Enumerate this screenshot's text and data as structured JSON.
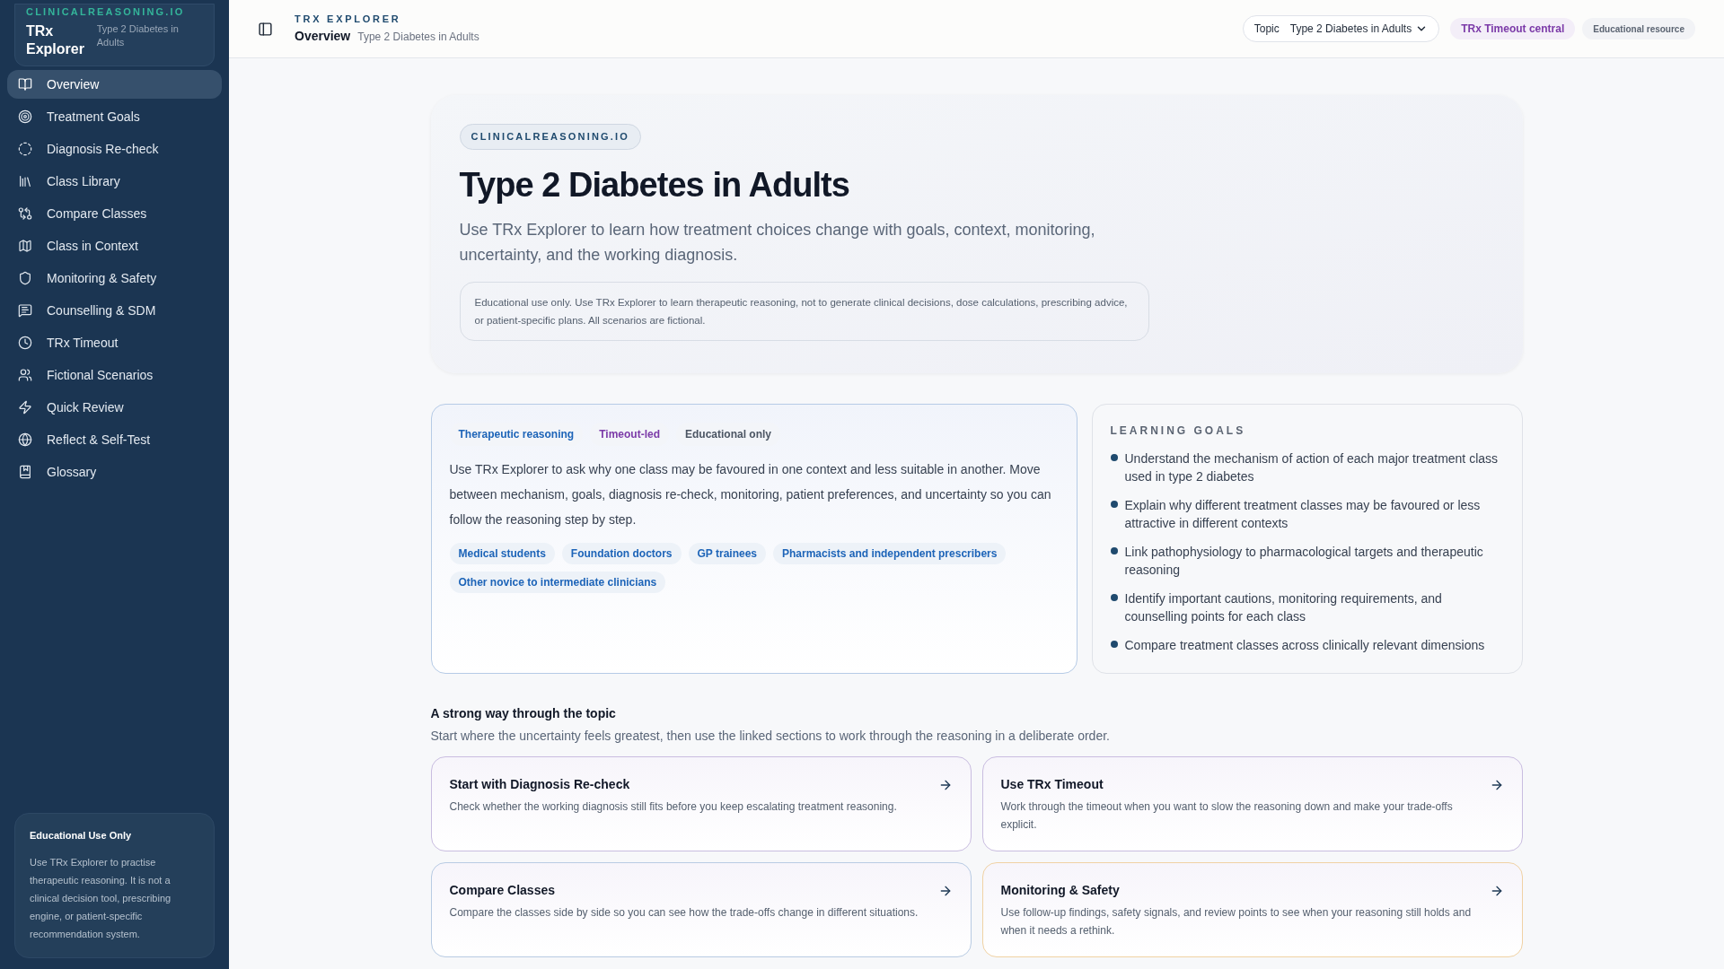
{
  "sidebar": {
    "brand": {
      "kicker": "CLINICALREASONING.IO",
      "title": "TRx Explorer",
      "subtitle": "Type 2 Diabetes in Adults"
    },
    "items": [
      {
        "label": "Overview",
        "selected": true
      },
      {
        "label": "Treatment Goals",
        "selected": false
      },
      {
        "label": "Diagnosis Re-check",
        "selected": false
      },
      {
        "label": "Class Library",
        "selected": false
      },
      {
        "label": "Compare Classes",
        "selected": false
      },
      {
        "label": "Class in Context",
        "selected": false
      },
      {
        "label": "Monitoring & Safety",
        "selected": false
      },
      {
        "label": "Counselling & SDM",
        "selected": false
      },
      {
        "label": "TRx Timeout",
        "selected": false
      },
      {
        "label": "Fictional Scenarios",
        "selected": false
      },
      {
        "label": "Quick Review",
        "selected": false
      },
      {
        "label": "Reflect & Self-Test",
        "selected": false
      },
      {
        "label": "Glossary",
        "selected": false
      }
    ],
    "notice": {
      "title": "Educational Use Only",
      "body": "Use TRx Explorer to practise therapeutic reasoning. It is not a clinical decision tool, prescribing engine, or patient-specific recommendation system."
    }
  },
  "header": {
    "kicker": "TRX EXPLORER",
    "title": "Overview",
    "subtitle": "Type 2 Diabetes in Adults",
    "topic_label": "Topic",
    "topic_value": "Type 2 Diabetes in Adults",
    "badges": [
      {
        "label": "TRx Timeout central",
        "color": "#7b3aa8"
      },
      {
        "label": "Educational resource",
        "color": "#5b6472"
      }
    ]
  },
  "hero": {
    "badge": "CLINICALREASONING.IO",
    "title": "Type 2 Diabetes in Adults",
    "lead": "Use TRx Explorer to learn how treatment choices change with goals, context, monitoring, uncertainty, and the working diagnosis.",
    "notice": "Educational use only. Use TRx Explorer to learn therapeutic reasoning, not to generate clinical decisions, dose calculations, prescribing advice, or patient-specific plans. All scenarios are fictional."
  },
  "intro": {
    "tags": [
      {
        "label": "Therapeutic reasoning",
        "color": "#1d64b8"
      },
      {
        "label": "Timeout-led",
        "color": "#7b3aa8"
      },
      {
        "label": "Educational only",
        "color": "#4b5563"
      }
    ],
    "body": "Use TRx Explorer to ask why one class may be favoured in one context and less suitable in another. Move between mechanism, goals, diagnosis re-check, monitoring, patient preferences, and uncertainty so you can follow the reasoning step by step.",
    "audiences": [
      "Medical students",
      "Foundation doctors",
      "GP trainees",
      "Pharmacists and independent prescribers",
      "Other novice to intermediate clinicians"
    ]
  },
  "learning_goals": {
    "title": "LEARNING GOALS",
    "items": [
      "Understand the mechanism of action of each major treatment class used in type 2 diabetes",
      "Explain why different treatment classes may be favoured or less attractive in different contexts",
      "Link pathophysiology to pharmacological targets and therapeutic reasoning",
      "Identify important cautions, monitoring requirements, and counselling points for each class",
      "Compare treatment classes across clinically relevant dimensions"
    ]
  },
  "pathway": {
    "title": "A strong way through the topic",
    "subtitle": "Start where the uncertainty feels greatest, then use the linked sections to work through the reasoning in a deliberate order.",
    "cards": [
      {
        "title": "Start with Diagnosis Re-check",
        "body": "Check whether the working diagnosis still fits before you keep escalating treatment reasoning.",
        "color": "#c9bde0"
      },
      {
        "title": "Use TRx Timeout",
        "body": "Work through the timeout when you want to slow the reasoning down and make your trade-offs explicit.",
        "color": "#c9bde0"
      },
      {
        "title": "Compare Classes",
        "body": "Compare the classes side by side so you can see how the trade-offs change in different situations.",
        "color": "#b8cbe3"
      },
      {
        "title": "Monitoring & Safety",
        "body": "Use follow-up findings, safety signals, and review points to see when your reasoning still holds and when it needs a rethink.",
        "color": "#f0d2a4"
      }
    ]
  }
}
